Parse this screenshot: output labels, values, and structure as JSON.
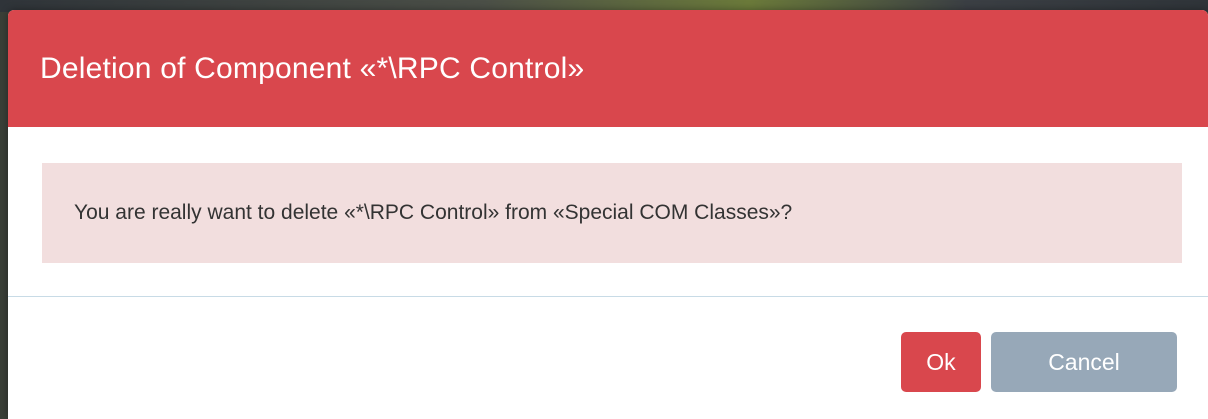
{
  "dialog": {
    "title": "Deletion of Component «*\\RPC Control»",
    "message": "You are really want to delete «*\\RPC Control» from «Special COM Classes»?",
    "buttons": {
      "ok_label": "Ok",
      "cancel_label": "Cancel"
    }
  },
  "colors": {
    "header": "#d9474d",
    "alert_background": "#f2dede",
    "ok_button": "#d9474d",
    "cancel_button": "#97a8b8"
  }
}
